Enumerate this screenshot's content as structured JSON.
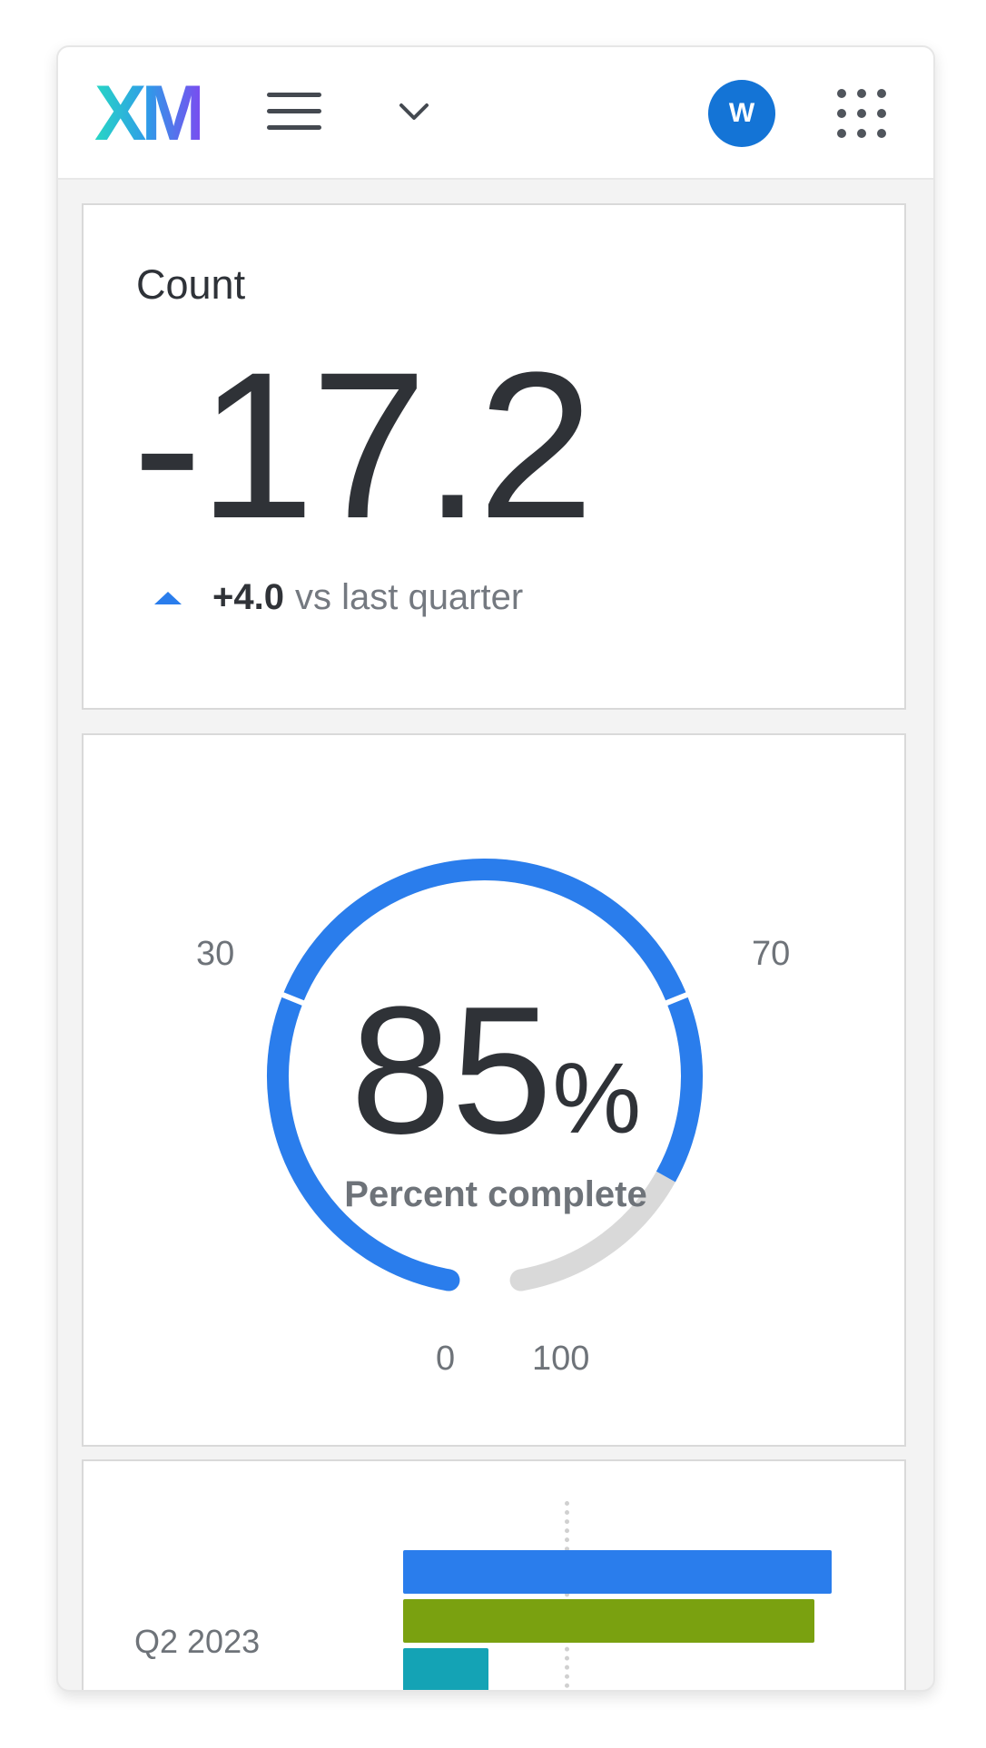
{
  "header": {
    "logo_text": "XM",
    "avatar_initial": "W",
    "icons": [
      "menu-icon",
      "chevron-down-icon",
      "app-grid-icon"
    ]
  },
  "count_widget": {
    "title": "Count",
    "value": "-17.2",
    "delta_value": "+4.0",
    "delta_text": "vs last quarter",
    "delta_direction": "up",
    "accent_color": "#2a7dec"
  },
  "gauge_widget": {
    "value": "85",
    "unit": "%",
    "caption": "Percent complete",
    "min_label": "0",
    "max_label": "100",
    "threshold_low_label": "30",
    "threshold_high_label": "70",
    "progress_fraction": 0.85,
    "fill_color": "#2a7dec",
    "track_color": "#d9d9d9"
  },
  "chart_data": {
    "type": "bar",
    "orientation": "horizontal",
    "categories": [
      "Q2 2023"
    ],
    "series_colors": [
      "#2a7dec",
      "#7aa110",
      "#14a3b5"
    ],
    "relative_values": [
      1.0,
      0.96,
      0.2
    ],
    "reference_line": true
  }
}
